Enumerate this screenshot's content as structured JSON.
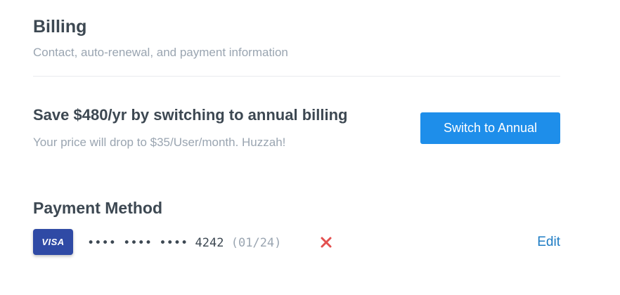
{
  "billing": {
    "title": "Billing",
    "subtitle": "Contact, auto-renewal, and payment information"
  },
  "promo": {
    "title": "Save $480/yr by switching to annual billing",
    "subtitle": "Your price will drop to $35/User/month. Huzzah!",
    "button_label": "Switch to Annual"
  },
  "payment_method": {
    "title": "Payment Method",
    "card_brand": "VISA",
    "card_mask": "•••• •••• ••••",
    "card_last4": "4242",
    "card_expiry": "(01/24)",
    "remove_icon": "close-icon",
    "edit_label": "Edit"
  },
  "colors": {
    "accent": "#1e8eea",
    "link": "#1e7cc4",
    "danger": "#e3504f",
    "visa": "#2f4aa5",
    "muted_text": "#9aa5b1",
    "primary_text": "#3d4852"
  }
}
